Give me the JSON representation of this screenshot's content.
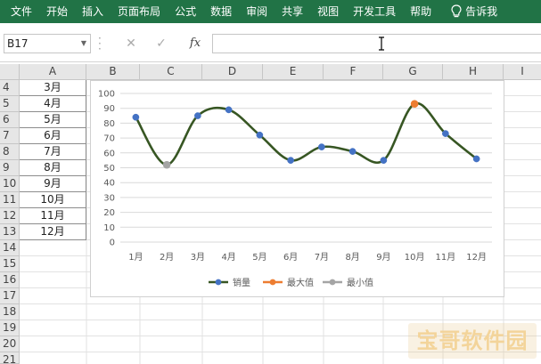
{
  "ribbon": {
    "tabs": [
      "文件",
      "开始",
      "插入",
      "页面布局",
      "公式",
      "数据",
      "审阅",
      "共享",
      "视图",
      "开发工具",
      "帮助"
    ],
    "tell_me": "告诉我"
  },
  "formula_bar": {
    "name_box": "B17",
    "cancel_icon": "✕",
    "enter_icon": "✓",
    "fx_label": "fx",
    "formula": ""
  },
  "sheet": {
    "columns": [
      "A",
      "B",
      "C",
      "D",
      "E",
      "F",
      "G",
      "H",
      "I"
    ],
    "rows": [
      "4",
      "5",
      "6",
      "7",
      "8",
      "9",
      "10",
      "11",
      "12",
      "13",
      "14",
      "15",
      "16",
      "17",
      "18",
      "19",
      "20",
      "21"
    ],
    "col_a_values": [
      "3月",
      "4月",
      "5月",
      "6月",
      "7月",
      "8月",
      "9月",
      "10月",
      "11月",
      "12月"
    ]
  },
  "chart_data": {
    "type": "line",
    "categories": [
      "1月",
      "2月",
      "3月",
      "4月",
      "5月",
      "6月",
      "7月",
      "8月",
      "9月",
      "10月",
      "11月",
      "12月"
    ],
    "series": [
      {
        "name": "销量",
        "values": [
          84,
          52,
          85,
          89,
          72,
          55,
          64,
          61,
          55,
          93,
          73,
          56
        ],
        "color": "#375623"
      },
      {
        "name": "最大值",
        "values": [
          null,
          null,
          null,
          null,
          null,
          null,
          null,
          null,
          null,
          93,
          null,
          null
        ],
        "color": "#ed7d31"
      },
      {
        "name": "最小值",
        "values": [
          null,
          52,
          null,
          null,
          null,
          null,
          null,
          null,
          null,
          null,
          null,
          null
        ],
        "color": "#a5a5a5"
      }
    ],
    "marker_color": "#4472c4",
    "yticks": [
      "0",
      "10",
      "20",
      "30",
      "40",
      "50",
      "60",
      "70",
      "80",
      "90",
      "100"
    ],
    "ylim": [
      0,
      100
    ],
    "grid": true,
    "legend": "bottom"
  },
  "watermark": "宝哥软件园"
}
